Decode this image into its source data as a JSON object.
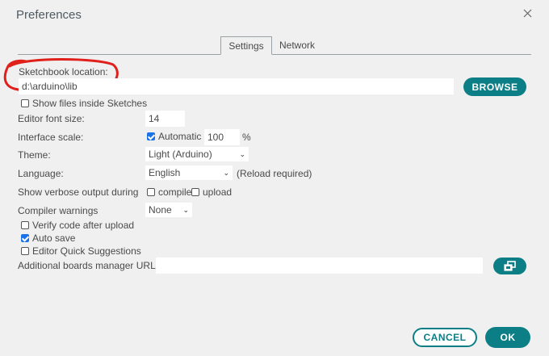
{
  "dialog": {
    "title": "Preferences"
  },
  "tabs": [
    {
      "label": "Settings",
      "active": true
    },
    {
      "label": "Network",
      "active": false
    }
  ],
  "sketchbook": {
    "label": "Sketchbook location:",
    "value": "d:\\arduino\\lib",
    "browse_label": "BROWSE",
    "show_files_label": "Show files inside Sketches",
    "show_files_checked": false
  },
  "editor_font_size": {
    "label": "Editor font size:",
    "value": "14"
  },
  "interface_scale": {
    "label": "Interface scale:",
    "automatic_label": "Automatic",
    "automatic_checked": true,
    "value": "100",
    "unit": "%"
  },
  "theme": {
    "label": "Theme:",
    "selected": "Light (Arduino)"
  },
  "language": {
    "label": "Language:",
    "selected": "English",
    "note": "(Reload required)"
  },
  "verbose": {
    "label": "Show verbose output during",
    "compile_label": "compile",
    "compile_checked": false,
    "upload_label": "upload",
    "upload_checked": false
  },
  "compiler_warnings": {
    "label": "Compiler warnings",
    "selected": "None"
  },
  "checkboxes": [
    {
      "label": "Verify code after upload",
      "checked": false
    },
    {
      "label": "Auto save",
      "checked": true
    },
    {
      "label": "Editor Quick Suggestions",
      "checked": false
    }
  ],
  "boards_manager": {
    "label": "Additional boards manager URLs:",
    "value": "",
    "button_icon": "open-window-icon"
  },
  "footer": {
    "cancel_label": "CANCEL",
    "ok_label": "OK"
  },
  "colors": {
    "accent": "#0b7e86",
    "annotation": "#e0201b",
    "checkbox": "#1a73e8",
    "background": "#f0f0f0"
  }
}
